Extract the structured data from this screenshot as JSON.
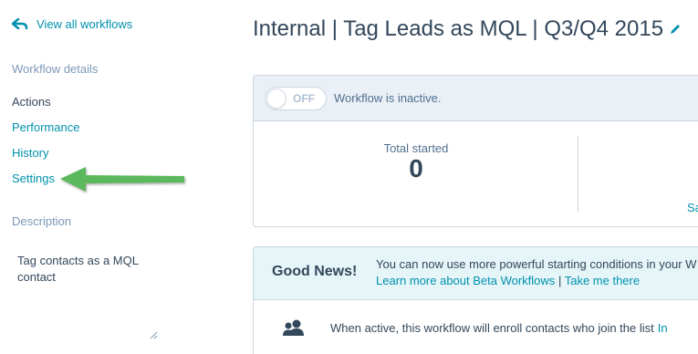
{
  "sidebar": {
    "back_link": "View all workflows",
    "section_details": "Workflow details",
    "nav": [
      {
        "label": "Actions",
        "active": true
      },
      {
        "label": "Performance",
        "active": false
      },
      {
        "label": "History",
        "active": false
      },
      {
        "label": "Settings",
        "active": false
      }
    ],
    "section_description": "Description",
    "description_value": "Tag contacts as a MQL contact"
  },
  "main": {
    "title": "Internal | Tag Leads as MQL | Q3/Q4 2015",
    "status": {
      "toggle_label": "OFF",
      "status_text": "Workflow is inactive."
    },
    "stats": {
      "total_started_label": "Total started",
      "total_started_value": "0",
      "partial_link": "Sa"
    },
    "news": {
      "title": "Good News!",
      "message": "You can now use more powerful starting conditions in your W",
      "learn_link": "Learn more about Beta Workflows",
      "separator": "|",
      "take_link": "Take me there"
    },
    "enroll": {
      "text": "When active, this workflow will enroll contacts who join the list",
      "link": "In"
    }
  },
  "colors": {
    "accent": "#0091ae",
    "text": "#33475b",
    "arrow": "#5cb85c",
    "banner": "#e5f5f8",
    "status_bar": "#eaf0f6"
  }
}
